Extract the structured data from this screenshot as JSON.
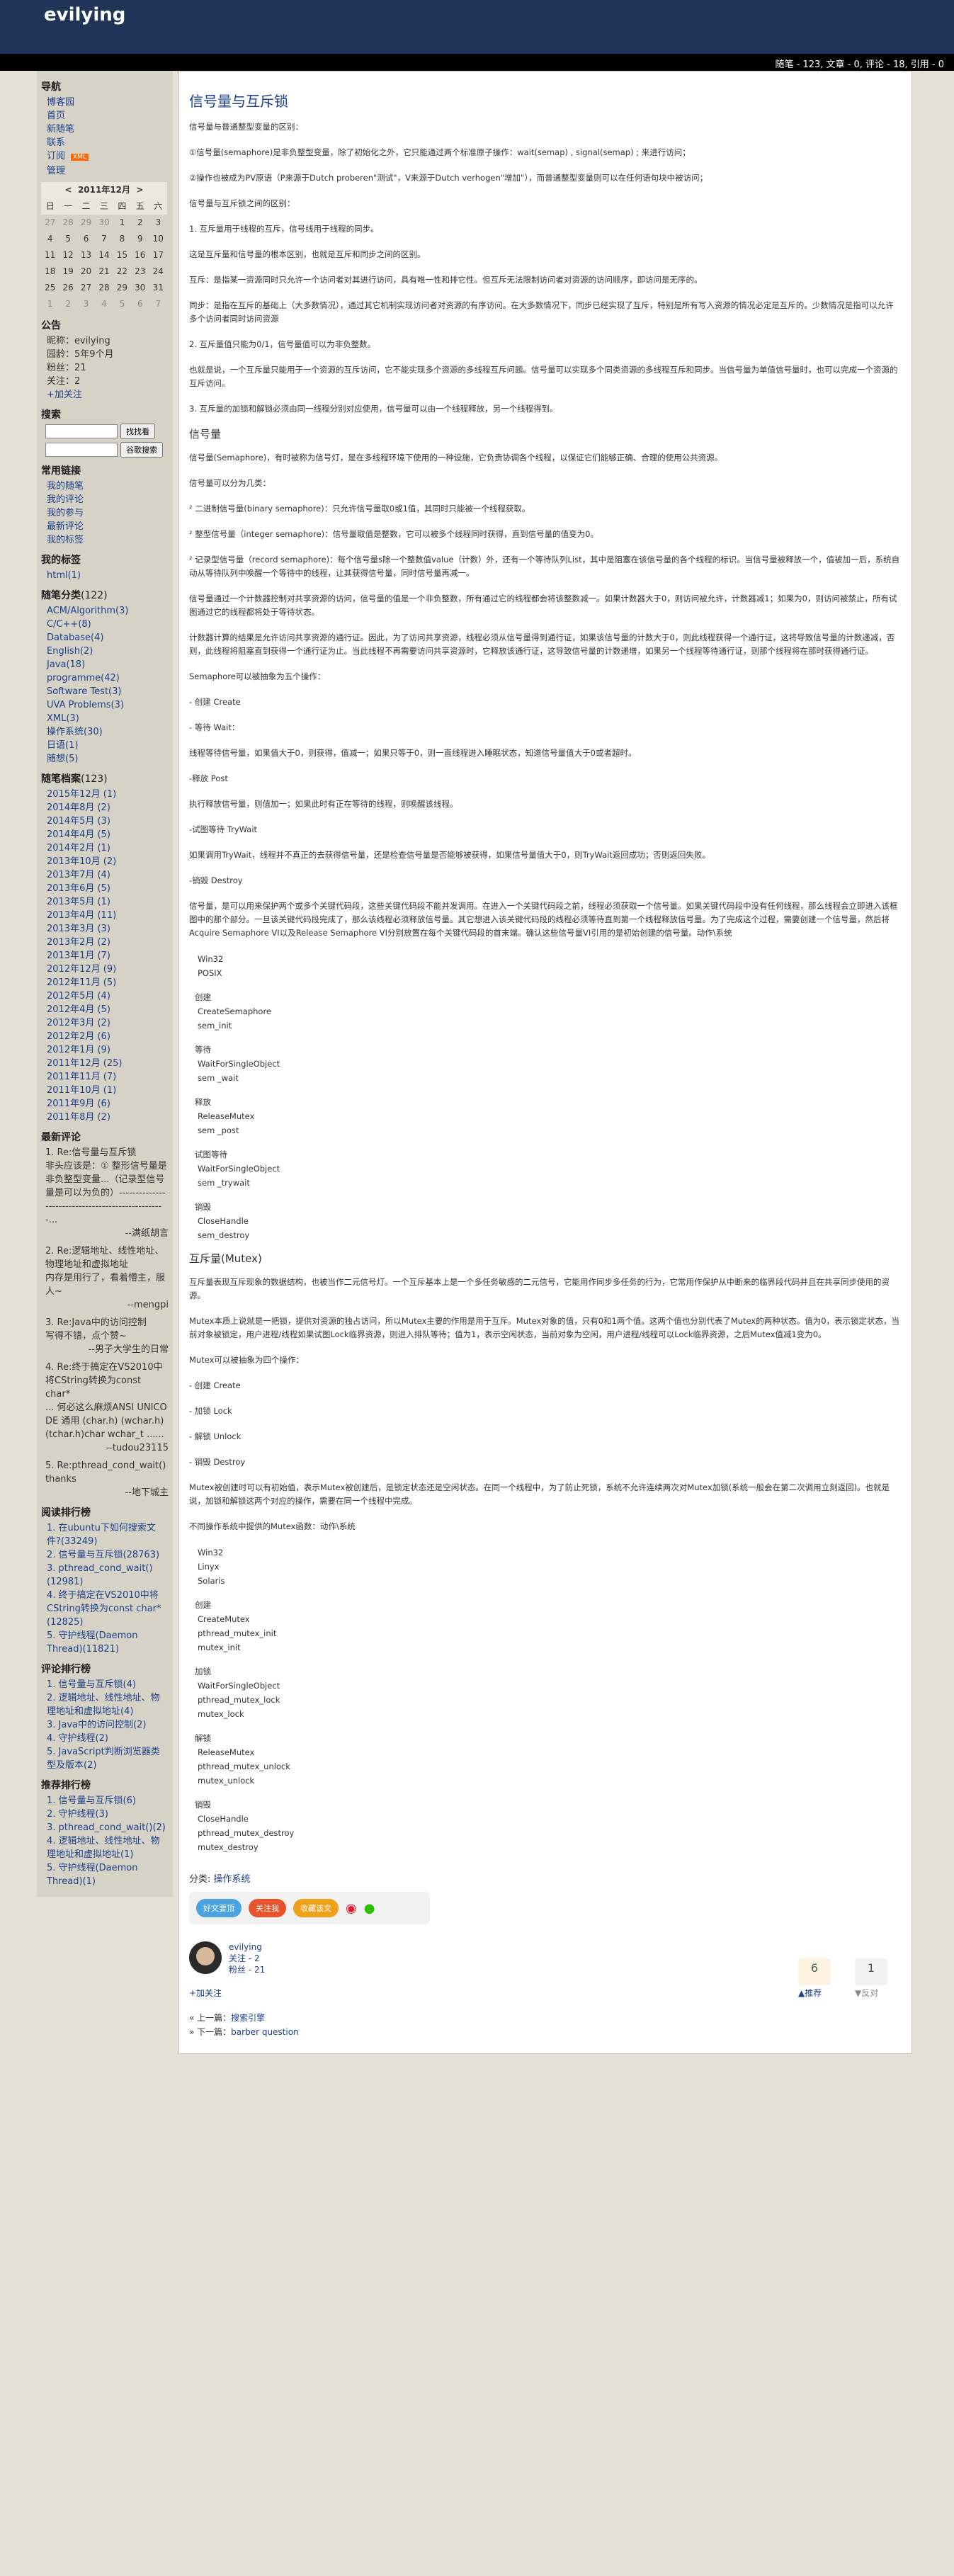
{
  "header": {
    "blog_title": "evilying",
    "stats": "随笔 - 123, 文章 - 0, 评论 - 18, 引用 - 0"
  },
  "sidebar": {
    "nav_heading": "导航",
    "nav_items": [
      "博客园",
      "首页",
      "新随笔",
      "联系",
      "订阅",
      "管理"
    ],
    "rss_badge": "XML",
    "calendar": {
      "caption": "2011年12月",
      "prev": "<",
      "next": ">",
      "weekdays": [
        "日",
        "一",
        "二",
        "三",
        "四",
        "五",
        "六"
      ],
      "weeks": [
        [
          "27",
          "28",
          "29",
          "30",
          "1",
          "2",
          "3"
        ],
        [
          "4",
          "5",
          "6",
          "7",
          "8",
          "9",
          "10"
        ],
        [
          "11",
          "12",
          "13",
          "14",
          "15",
          "16",
          "17"
        ],
        [
          "18",
          "19",
          "20",
          "21",
          "22",
          "23",
          "24"
        ],
        [
          "25",
          "26",
          "27",
          "28",
          "29",
          "30",
          "31"
        ],
        [
          "1",
          "2",
          "3",
          "4",
          "5",
          "6",
          "7"
        ]
      ]
    },
    "announce_heading": "公告",
    "announce_lines": [
      "昵称：evilying",
      "园龄：5年9个月",
      "粉丝：21",
      "关注：2",
      "+加关注"
    ],
    "search_heading": "搜索",
    "search_button": "找找看",
    "google_button": "谷歌搜索",
    "links_heading": "常用链接",
    "links": [
      "我的随笔",
      "我的评论",
      "我的参与",
      "最新评论",
      "我的标签"
    ],
    "tags_heading": "我的标签",
    "tags": [
      "html(1)"
    ],
    "cats_heading": "随笔分类",
    "cats_count": "(122)",
    "cats": [
      "ACM/Algorithm(3)",
      "C/C++(8)",
      "Database(4)",
      "English(2)",
      "Java(18)",
      "programme(42)",
      "Software Test(3)",
      "UVA Problems(3)",
      "XML(3)",
      "操作系统(30)",
      "日语(1)",
      "随想(5)"
    ],
    "archive_heading": "随笔档案",
    "archive_count": "(123)",
    "archives": [
      "2015年12月 (1)",
      "2014年8月 (2)",
      "2014年5月 (3)",
      "2014年4月 (5)",
      "2014年2月 (1)",
      "2013年10月 (2)",
      "2013年7月 (4)",
      "2013年6月 (5)",
      "2013年5月 (1)",
      "2013年4月 (11)",
      "2013年3月 (3)",
      "2013年2月 (2)",
      "2013年1月 (7)",
      "2012年12月 (9)",
      "2012年11月 (5)",
      "2012年5月 (4)",
      "2012年4月 (5)",
      "2012年3月 (2)",
      "2012年2月 (6)",
      "2012年1月 (9)",
      "2011年12月 (25)",
      "2011年11月 (7)",
      "2011年10月 (1)",
      "2011年9月 (6)",
      "2011年8月 (2)"
    ],
    "recent_heading": "最新评论",
    "recent_comments": [
      {
        "title": "1. Re:信号量与互斥锁",
        "text": "非头应该是：① 整形信号量是非负整型变量...（记录型信号量是可以为负的）--------------------------------------------------...",
        "author": "--满纸胡言"
      },
      {
        "title": "2. Re:逻辑地址、线性地址、物理地址和虚拟地址",
        "text": "内存是用行了，看着懵主，服人~",
        "author": "--mengpi"
      },
      {
        "title": "3. Re:Java中的访问控制",
        "text": "写得不错，点个赞~",
        "author": "--男子大学生的日常"
      },
      {
        "title": "4. Re:终于搞定在VS2010中将CString转换为const char*",
        "text": "... 何必这么麻烦ANSI UNICODE 通用 (char.h) (wchar.h) (tchar.h)char wchar_t ......",
        "author": "--tudou23115"
      },
      {
        "title": "5. Re:pthread_cond_wait()",
        "text": "thanks",
        "author": "--地下城主"
      }
    ],
    "read_heading": "阅读排行榜",
    "read_rank": [
      "1. 在ubuntu下如何搜索文件?(33249)",
      "2. 信号量与互斥锁(28763)",
      "3. pthread_cond_wait()(12981)",
      "4. 终于搞定在VS2010中将CString转换为const char*(12825)",
      "5. 守护线程(Daemon Thread)(11821)"
    ],
    "comment_heading": "评论排行榜",
    "comment_rank": [
      "1. 信号量与互斥锁(4)",
      "2. 逻辑地址、线性地址、物理地址和虚拟地址(4)",
      "3. Java中的访问控制(2)",
      "4. 守护线程(2)",
      "5. JavaScript判断浏览器类型及版本(2)"
    ],
    "recommend_heading": "推荐排行榜",
    "recommend_rank": [
      "1. 信号量与互斥锁(6)",
      "2. 守护线程(3)",
      "3. pthread_cond_wait()(2)",
      "4. 逻辑地址、线性地址、物理地址和虚拟地址(1)",
      "5. 守护线程(Daemon Thread)(1)"
    ]
  },
  "post": {
    "title": "信号量与互斥锁",
    "intro": [
      "信号量与普通整型变量的区别：",
      "①信号量(semaphore)是非负整型变量，除了初始化之外，它只能通过两个标准原子操作：wait(semap) , signal(semap) ; 来进行访问；",
      "②操作也被成为PV原语（P来源于Dutch proberen\"测试\"，V来源于Dutch verhogen\"增加\"），而普通整型变量则可以在任何语句块中被访问；",
      "信号量与互斥锁之间的区别：",
      "1. 互斥量用于线程的互斥，信号线用于线程的同步。",
      "这是互斥量和信号量的根本区别，也就是互斥和同步之间的区别。",
      "互斥：是指某一资源同时只允许一个访问者对其进行访问，具有唯一性和排它性。但互斥无法限制访问者对资源的访问顺序，即访问是无序的。",
      "同步：是指在互斥的基础上（大多数情况），通过其它机制实现访问者对资源的有序访问。在大多数情况下，同步已经实现了互斥，特别是所有写入资源的情况必定是互斥的。少数情况是指可以允许多个访问者同时访问资源",
      "2. 互斥量值只能为0/1，信号量值可以为非负整数。",
      "也就是说，一个互斥量只能用于一个资源的互斥访问，它不能实现多个资源的多线程互斥问题。信号量可以实现多个同类资源的多线程互斥和同步。当信号量为单值信号量时，也可以完成一个资源的互斥访问。",
      "3. 互斥量的加锁和解锁必须由同一线程分别对应使用，信号量可以由一个线程释放，另一个线程得到。"
    ],
    "sem_heading": "信号量",
    "sem_text": [
      "信号量(Semaphore)，有时被称为信号灯，是在多线程环境下使用的一种设施，它负责协调各个线程，以保证它们能够正确、合理的使用公共资源。",
      "信号量可以分为几类：",
      "² 二进制信号量(binary semaphore)：只允许信号量取0或1值，其同时只能被一个线程获取。",
      "² 整型信号量（integer semaphore)：信号量取值是整数，它可以被多个线程同时获得，直到信号量的值变为0。",
      "² 记录型信号量（record semaphore)：每个信号量s除一个整数值value（计数）外，还有一个等待队列List，其中是阻塞在该信号量的各个线程的标识。当信号量被释放一个，值被加一后，系统自动从等待队列中唤醒一个等待中的线程，让其获得信号量，同时信号量再减一。",
      "信号量通过一个计数器控制对共享资源的访问，信号量的值是一个非负整数，所有通过它的线程都会将该整数减一。如果计数器大于0，则访问被允许，计数器减1；如果为0，则访问被禁止，所有试图通过它的线程都将处于等待状态。",
      "计数器计算的结果是允许访问共享资源的通行证。因此，为了访问共享资源，线程必须从信号量得到通行证，如果该信号量的计数大于0，则此线程获得一个通行证，这将导致信号量的计数递减，否则，此线程将阻塞直到获得一个通行证为止。当此线程不再需要访问共享资源时，它释放该通行证，这导致信号量的计数递增，如果另一个线程等待通行证，则那个线程将在那时获得通行证。",
      "Semaphore可以被抽象为五个操作：",
      "- 创建 Create",
      "- 等待 Wait：",
      "线程等待信号量，如果值大于0，则获得，值减一；如果只等于0，则一直线程进入睡眠状态，知道信号量值大于0或者超时。",
      "-释放 Post",
      "执行释放信号量，则值加一；如果此时有正在等待的线程，则唤醒该线程。",
      "-试图等待 TryWait",
      "如果调用TryWait，线程并不真正的去获得信号量，还是检查信号量是否能够被获得，如果信号量值大于0，则TryWait返回成功；否则返回失败。",
      "-销毁 Destroy",
      "信号量，是可以用来保护两个或多个关键代码段，这些关键代码段不能并发调用。在进入一个关键代码段之前，线程必须获取一个信号量。如果关键代码段中没有任何线程，那么线程会立即进入该框图中的那个部分。一旦该关键代码段完成了，那么该线程必须释放信号量。其它想进入该关键代码段的线程必须等待直到第一个线程释放信号量。为了完成这个过程，需要创建一个信号量，然后将Acquire Semaphore VI以及Release Semaphore VI分别放置在每个关键代码段的首末端。确认这些信号量VI引用的是初始创建的信号量。动作\\系统"
    ],
    "sem_ops": [
      {
        "label": "",
        "items": [
          "Win32",
          "POSIX"
        ]
      },
      {
        "label": "创建",
        "items": [
          "CreateSemaphore",
          "sem_init"
        ]
      },
      {
        "label": "等待",
        "items": [
          "WaitForSingleObject",
          "sem _wait"
        ]
      },
      {
        "label": "释放",
        "items": [
          "ReleaseMutex",
          "sem _post"
        ]
      },
      {
        "label": "试图等待",
        "items": [
          "WaitForSingleObject",
          "sem _trywait"
        ]
      },
      {
        "label": "销毁",
        "items": [
          "CloseHandle",
          "sem_destroy"
        ]
      }
    ],
    "mutex_heading": "互斥量(Mutex)",
    "mutex_text": [
      "互斥量表现互斥现象的数据结构，也被当作二元信号灯。一个互斥基本上是一个多任务敏感的二元信号，它能用作同步多任务的行为，它常用作保护从中断来的临界段代码并且在共享同步使用的资源。",
      "Mutex本质上说就是一把锁，提供对资源的独占访问，所以Mutex主要的作用是用于互斥。Mutex对象的值，只有0和1两个值。这两个值也分别代表了Mutex的两种状态。值为0，表示锁定状态，当前对象被锁定，用户进程/线程如果试图Lock临界资源，则进入排队等待；值为1，表示空闲状态，当前对象为空闲，用户进程/线程可以Lock临界资源，之后Mutex值减1变为0。",
      "Mutex可以被抽象为四个操作：",
      "- 创建 Create",
      "- 加锁 Lock",
      "- 解锁 Unlock",
      "- 销毁 Destroy",
      "Mutex被创建时可以有初始值，表示Mutex被创建后，是锁定状态还是空闲状态。在同一个线程中，为了防止死锁，系统不允许连续两次对Mutex加锁(系统一般会在第二次调用立刻返回)。也就是说，加锁和解锁这两个对应的操作，需要在同一个线程中完成。",
      "不同操作系统中提供的Mutex函数：动作\\系统"
    ],
    "mutex_ops": [
      {
        "label": "",
        "items": [
          "Win32",
          "Linyx",
          "Solaris"
        ]
      },
      {
        "label": "创建",
        "items": [
          "CreateMutex",
          "pthread_mutex_init",
          "mutex_init"
        ]
      },
      {
        "label": "加锁",
        "items": [
          "WaitForSingleObject",
          "pthread_mutex_lock",
          "mutex_lock"
        ]
      },
      {
        "label": "解锁",
        "items": [
          "ReleaseMutex",
          "pthread_mutex_unlock",
          "mutex_unlock"
        ]
      },
      {
        "label": "销毁",
        "items": [
          "CloseHandle",
          "pthread_mutex_destroy",
          "mutex_destroy"
        ]
      }
    ],
    "category_label": "分类:",
    "category": "操作系统",
    "share_buttons": [
      "好文要顶",
      "关注我",
      "收藏该文"
    ],
    "author_name": "evilying",
    "author_follow": "关注 - 2",
    "author_fans": "粉丝 - 21",
    "follow_link": "+加关注",
    "recommend_count": "6",
    "recommend_label": "推荐",
    "oppose_count": "1",
    "oppose_label": "反对",
    "prev_post_label": "« 上一篇：",
    "prev_post": "搜索引擎",
    "next_post_label": "» 下一篇：",
    "next_post": "barber question"
  },
  "colors": {
    "header": "#1f3457",
    "sidebar": "#d6d3c6",
    "link": "#1a3f8c",
    "bg": "#e4e2d6"
  }
}
